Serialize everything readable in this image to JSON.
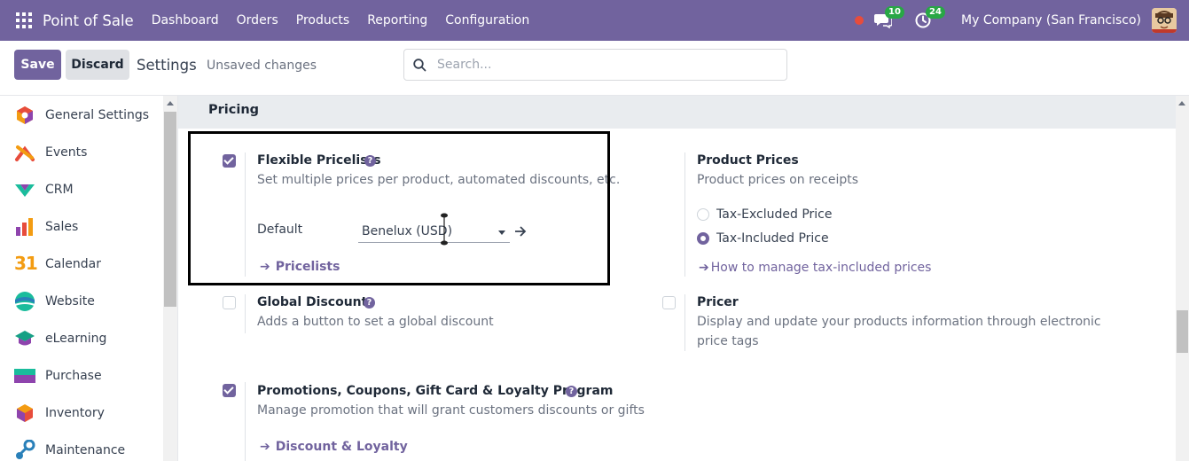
{
  "navbar": {
    "brand": "Point of Sale",
    "menu": [
      "Dashboard",
      "Orders",
      "Products",
      "Reporting",
      "Configuration"
    ],
    "messages_count": "10",
    "activities_count": "24",
    "company": "My Company (San Francisco)"
  },
  "control": {
    "save_label": "Save",
    "discard_label": "Discard",
    "title": "Settings",
    "status": "Unsaved changes",
    "search_placeholder": "Search..."
  },
  "sidebar": {
    "items": [
      {
        "label": "General Settings",
        "icon": "general-settings-icon"
      },
      {
        "label": "Events",
        "icon": "events-icon"
      },
      {
        "label": "CRM",
        "icon": "crm-icon"
      },
      {
        "label": "Sales",
        "icon": "sales-icon"
      },
      {
        "label": "Calendar",
        "icon": "calendar-icon"
      },
      {
        "label": "Website",
        "icon": "website-icon"
      },
      {
        "label": "eLearning",
        "icon": "elearning-icon"
      },
      {
        "label": "Purchase",
        "icon": "purchase-icon"
      },
      {
        "label": "Inventory",
        "icon": "inventory-icon"
      },
      {
        "label": "Maintenance",
        "icon": "maintenance-icon"
      }
    ],
    "calendar_day": "31"
  },
  "pricing": {
    "section_title": "Pricing",
    "flexible_pricelists": {
      "title": "Flexible Pricelists",
      "desc": "Set multiple prices per product, automated discounts, etc.",
      "checked": true,
      "default_label": "Default",
      "default_value": "Benelux (USD)",
      "link": "Pricelists"
    },
    "product_prices": {
      "title": "Product Prices",
      "desc": "Product prices on receipts",
      "options": [
        "Tax-Excluded Price",
        "Tax-Included Price"
      ],
      "selected": "Tax-Included Price",
      "link": "How to manage tax-included prices"
    },
    "global_discounts": {
      "title": "Global Discounts",
      "desc": "Adds a button to set a global discount",
      "checked": false
    },
    "pricer": {
      "title": "Pricer",
      "desc_line1": "Display and update your products information through electronic",
      "desc_line2": "price tags",
      "checked": false
    },
    "promotions": {
      "title": "Promotions, Coupons, Gift Card & Loyalty Program",
      "desc": "Manage promotion that will grant customers discounts or gifts",
      "checked": true,
      "link": "Discount & Loyalty"
    }
  },
  "colors": {
    "brand": "#71639e",
    "badge": "#28a745",
    "record": "#e74c3c"
  }
}
